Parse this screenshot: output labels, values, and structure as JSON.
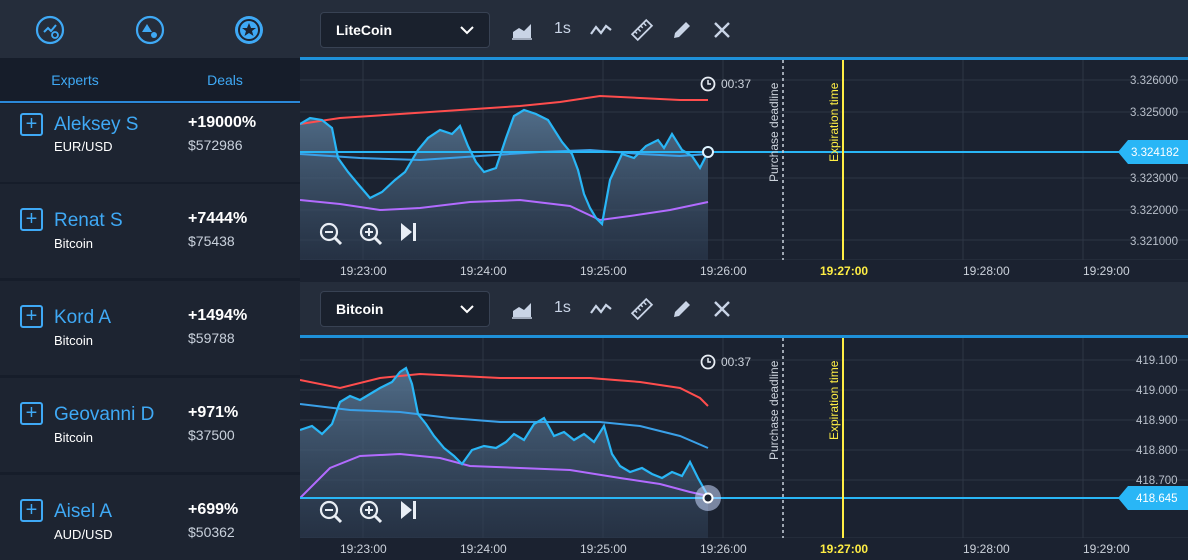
{
  "sidebar": {
    "tabs": {
      "experts": "Experts",
      "deals": "Deals"
    },
    "experts": [
      {
        "name": "Aleksey S",
        "asset": "EUR/USD",
        "percent": "+19000%",
        "amount": "$572986"
      },
      {
        "name": "Renat S",
        "asset": "Bitcoin",
        "percent": "+7444%",
        "amount": "$75438"
      },
      {
        "name": "Kord A",
        "asset": "Bitcoin",
        "percent": "+1494%",
        "amount": "$59788"
      },
      {
        "name": "Geovanni D",
        "asset": "Bitcoin",
        "percent": "+971%",
        "amount": "$37500"
      },
      {
        "name": "Aisel A",
        "asset": "AUD/USD",
        "percent": "+699%",
        "amount": "$50362"
      }
    ],
    "top_icons": [
      "history-icon",
      "shapes-icon",
      "star-badge-icon"
    ]
  },
  "charts": [
    {
      "asset": "LiteCoin",
      "interval": "1s",
      "timer": "00:37",
      "purchase_deadline": "Purchase deadline",
      "expiration_time": "Expiration time",
      "current_price": "3.324182",
      "y_ticks": [
        "3.326000",
        "3.325000",
        "3.323000",
        "3.322000",
        "3.321000"
      ],
      "x_ticks": [
        "19:23:00",
        "19:24:00",
        "19:25:00",
        "19:26:00",
        "19:27:00",
        "19:28:00",
        "19:29:00"
      ]
    },
    {
      "asset": "Bitcoin",
      "interval": "1s",
      "timer": "00:37",
      "purchase_deadline": "Purchase deadline",
      "expiration_time": "Expiration time",
      "current_price": "418.645",
      "y_ticks": [
        "419.100",
        "419.000",
        "418.900",
        "418.800",
        "418.700"
      ],
      "x_ticks": [
        "19:23:00",
        "19:24:00",
        "19:25:00",
        "19:26:00",
        "19:27:00",
        "19:28:00",
        "19:29:00"
      ]
    }
  ],
  "colors": {
    "accent": "#3fa9f5",
    "price_line": "#29b6f6",
    "upper_band": "#ff4d4d",
    "middle_band": "#3aa0e8",
    "lower_band": "#b26bff",
    "expiration": "#ffee44"
  }
}
